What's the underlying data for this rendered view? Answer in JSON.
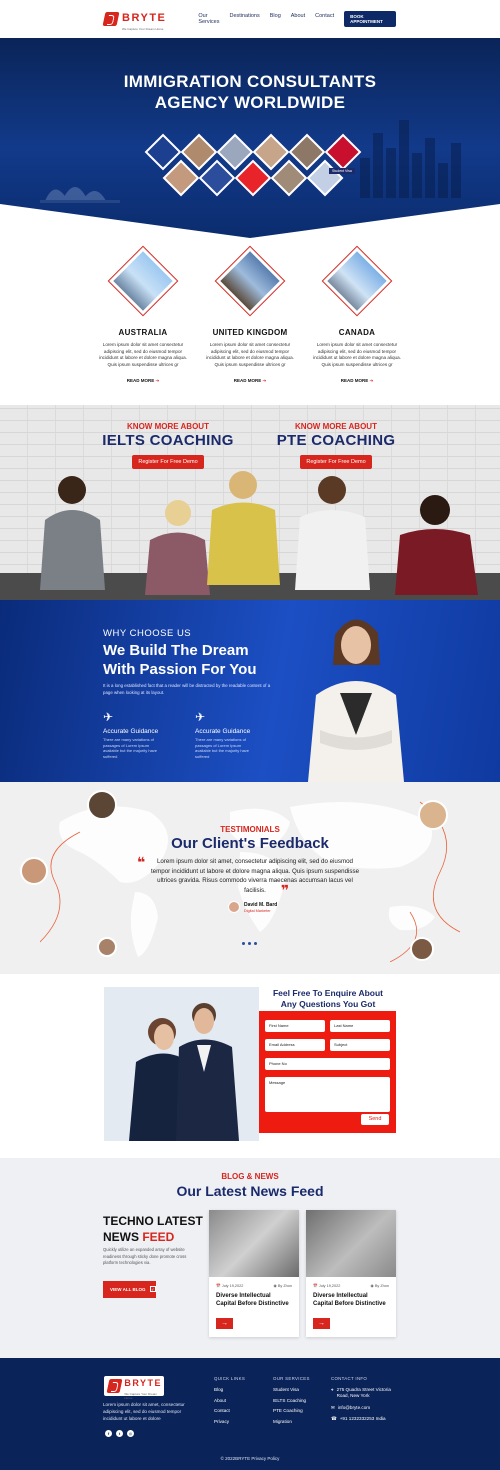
{
  "nav": {
    "brand": "BRYTE",
    "tagline": "We Capture Your Dream Home",
    "links": [
      "Our Services",
      "Destinations",
      "Blog",
      "About",
      "Contact"
    ],
    "cta": "BOOK APPOINTMENT"
  },
  "hero": {
    "title_line1": "IMMIGRATION CONSULTANTS",
    "title_line2": "AGENCY WORLDWIDE",
    "badge": "Student Visa"
  },
  "destinations": [
    {
      "name": "AUSTRALIA",
      "text": "Lorem ipsum dolor sit amet consectetur adipiscing elit, sed do eiusmod tempor incididunt ut labore et dolore magna aliqua. Quis ipsum suspendisse ultrices gr",
      "link": "READ MORE"
    },
    {
      "name": "UNITED KINGDOM",
      "text": "Lorem ipsum dolor sit amet consectetur adipiscing elit, sed do eiusmod tempor incididunt ut labore et dolore magna aliqua. Quis ipsum suspendisse ultrices gr",
      "link": "READ MORE"
    },
    {
      "name": "CANADA",
      "text": "Lorem ipsum dolor sit amet consectetur adipiscing elit, sed do eiusmod tempor incididunt ut labore et dolore magna aliqua. Quis ipsum suspendisse ultrices gr",
      "link": "READ MORE"
    }
  ],
  "coaching": [
    {
      "kicker": "KNOW MORE ABOUT",
      "title": "IELTS COACHING",
      "button": "Register For Free Demo"
    },
    {
      "kicker": "KNOW MORE ABOUT",
      "title": "PTE COACHING",
      "button": "Register For Free Demo"
    }
  ],
  "why": {
    "kicker": "WHY CHOOSE US",
    "title_line1": "We Build The Dream",
    "title_line2": "With Passion For You",
    "text": "It is a long established fact that a reader will be distracted by the readable content of a page when looking at its layout.",
    "features": [
      {
        "title": "Accurate Guidance",
        "text": "There are many variations of passages of Lorem Ipsum available but the majority have suffered"
      },
      {
        "title": "Accurate Guidance",
        "text": "There are many variations of passages of Lorem Ipsum available but the majority have suffered"
      }
    ]
  },
  "testimonials": {
    "kicker": "TESTIMONIALS",
    "title": "Our Client's Feedback",
    "quote": "Lorem ipsum dolor sit amet, consectetur adipiscing elit, sed do eiusmod tempor incididunt ut labore et dolore magna aliqua. Quis ipsum suspendisse ultrices gravida. Risus commodo viverra maecenas accumsan lacus vel facilisis.",
    "author": "David M. Bard",
    "role": "Digital Marketer"
  },
  "enquiry": {
    "title_line1": "Feel Free To Enquire About",
    "title_line2": "Any Questions You Got",
    "fields": {
      "first_name": "First Name",
      "last_name": "Last Name",
      "email": "Email Address",
      "subject": "Subject",
      "phone": "Phone No",
      "message": "Message"
    },
    "submit": "Send"
  },
  "news": {
    "kicker": "BLOG & NEWS",
    "title": "Our Latest News Feed",
    "feature_line1": "TECHNO LATEST",
    "feature_line2a": "NEWS ",
    "feature_line2b": "FEED",
    "feature_text": "Quickly utilize an expanded array of website readiness through sticky done promote cross platform technologies via.",
    "view_all": "VIEW ALL BLOG",
    "cards": [
      {
        "date": "July 19,2022",
        "author": "By Zhon",
        "title": "Diverse Intellectual Capital Before Distinctive"
      },
      {
        "date": "July 19,2022",
        "author": "By Zhon",
        "title": "Diverse Intellectual Capital Before Distinctive"
      }
    ]
  },
  "footer": {
    "about": "Lorem ipsum dolor sit amet, consectetur adipiscing elit, sed do eiusmod tempor incididunt ut labore et dolore",
    "quick_links_title": "QUICK LINKS",
    "quick_links": [
      "Blog",
      "About",
      "Contact",
      "Privacy"
    ],
    "services_title": "OUR SERVICES",
    "services": [
      "Student Visa",
      "IELTS Coaching",
      "PTE Coaching",
      "Migration"
    ],
    "contact_title": "CONTACT INFO",
    "address": "275 Quadra Street Victoria Road, New York",
    "email": "info@bryte.com",
    "phone": "+91 1232332253 India",
    "copyright": "© 2022BRYTE Privacy Policy"
  },
  "colors": {
    "brand_red": "#d7261e",
    "navy": "#0a2358",
    "title_blue": "#1b2a6b"
  }
}
